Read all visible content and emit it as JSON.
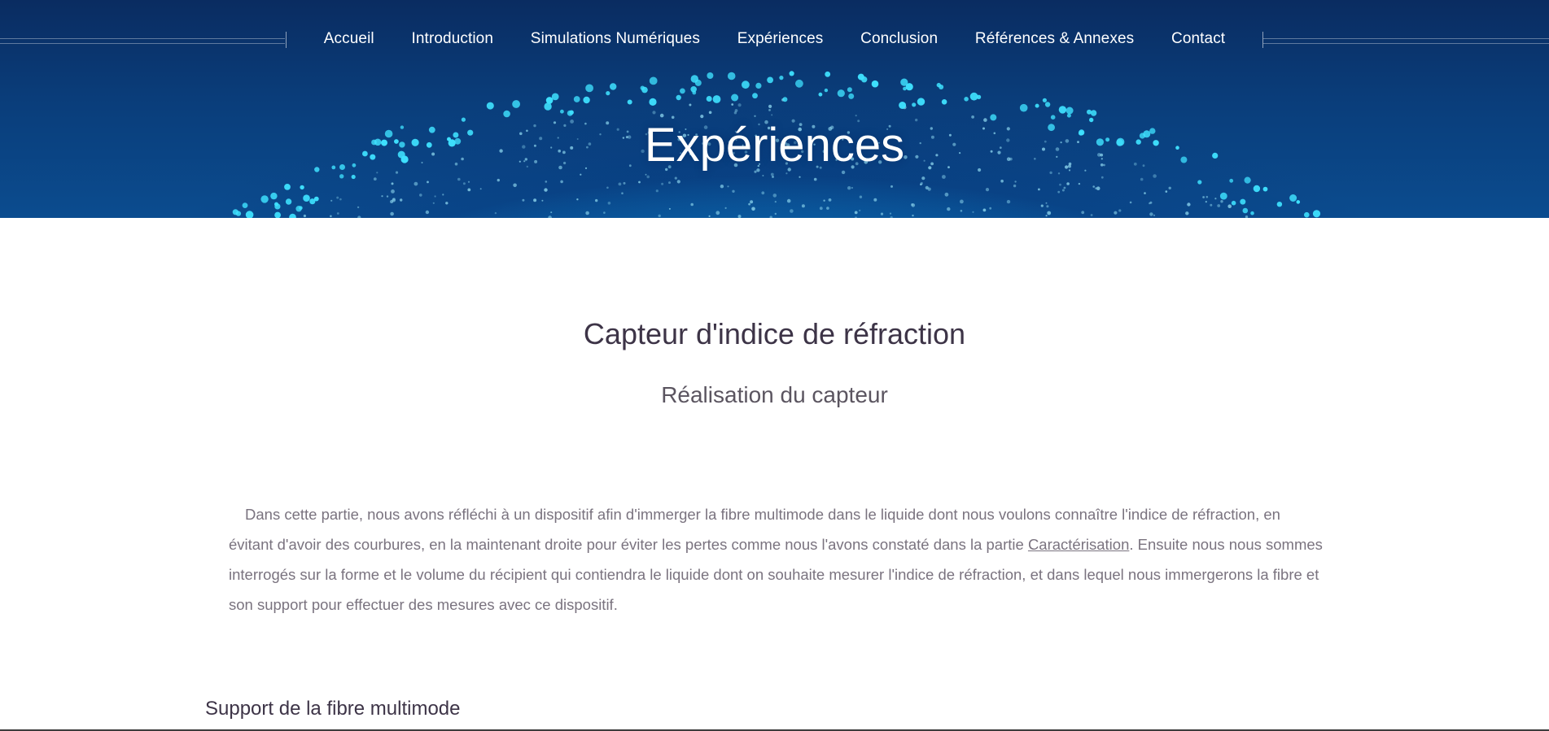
{
  "nav": {
    "items": [
      "Accueil",
      "Introduction",
      "Simulations Numériques",
      "Expériences",
      "Conclusion",
      "Références & Annexes",
      "Contact"
    ]
  },
  "hero": {
    "title": "Expériences"
  },
  "section": {
    "title": "Capteur d'indice de réfraction",
    "subtitle": "Réalisation du capteur"
  },
  "paragraph": {
    "before_link": "Dans cette partie, nous avons réfléchi à un dispositif afin d'immerger la fibre multimode dans le liquide dont nous voulons connaître l'indice de réfraction, en évitant d'avoir des courbures, en la maintenant droite pour éviter les pertes comme nous l'avons constaté dans la partie ",
    "link_text": "Caractérisation",
    "after_link": ". Ensuite nous nous sommes interrogés sur la forme et le volume du récipient qui contiendra le liquide dont on souhaite mesurer l'indice de réfraction, et dans lequel nous immergerons la fibre et son support pour effectuer des mesures avec ce dispositif."
  },
  "subsection": {
    "title": "Support de la fibre multimode"
  },
  "colors": {
    "hero_dark": "#0a2c61",
    "hero_glow": "#1ec8ff",
    "heading": "#3d3447",
    "body_text": "#7a737f"
  }
}
